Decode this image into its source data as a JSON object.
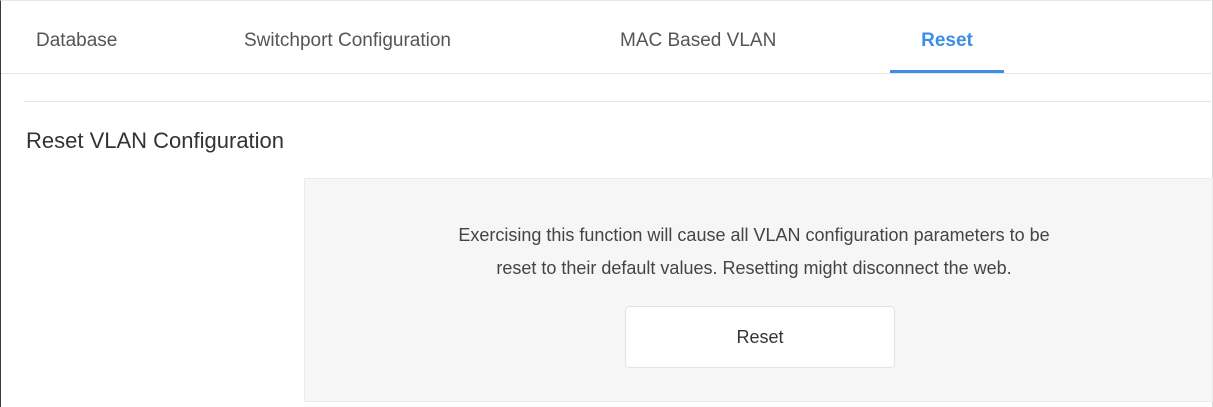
{
  "tabs": [
    {
      "label": "Database",
      "active": false
    },
    {
      "label": "Switchport Configuration",
      "active": false
    },
    {
      "label": "MAC Based VLAN",
      "active": false
    },
    {
      "label": "Reset",
      "active": true
    }
  ],
  "section": {
    "title": "Reset VLAN Configuration"
  },
  "panel": {
    "message_line1": "Exercising this function will cause all VLAN configuration parameters to be",
    "message_line2": "reset to their default values. Resetting might disconnect the web.",
    "button_label": "Reset"
  },
  "colors": {
    "accent": "#3d8ee8",
    "panel_bg": "#f6f6f6",
    "text": "#333333"
  }
}
